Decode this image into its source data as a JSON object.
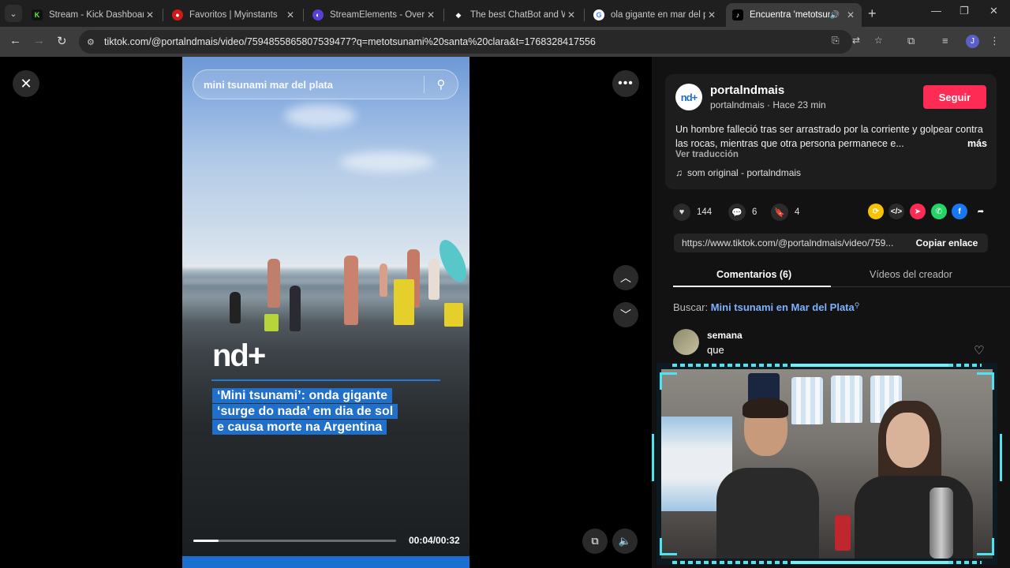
{
  "browser": {
    "tabs": [
      {
        "title": "Stream - Kick Dashboard",
        "favicon": "kick-icon",
        "color": "#53fc18"
      },
      {
        "title": "Favoritos | Myinstants",
        "favicon": "myinstants-icon",
        "color": "#d11a1a"
      },
      {
        "title": "StreamElements - Overlays",
        "favicon": "streamelements-icon",
        "color": "#5a3fd6"
      },
      {
        "title": "The best ChatBot and Wid",
        "favicon": "chatbot-icon",
        "color": "#ffffff"
      },
      {
        "title": "ola gigante en mar del pla",
        "favicon": "google-icon",
        "color": "#4285f4"
      },
      {
        "title": "Encuentra 'metotsuna",
        "favicon": "tiktok-icon",
        "color": "#000000",
        "active": true
      }
    ],
    "url": "tiktok.com/@portalndmais/video/7594855865807539477?q=metotsunami%20santa%20clara&t=1768328417556",
    "profile_initial": "J"
  },
  "video": {
    "search_query": "mini tsunami mar del plata",
    "logo_text": "nd+",
    "headline_lines": [
      "‘Mini tsunami’: onda gigante",
      "‘surge do nada’ em dia de sol",
      "e causa morte na Argentina"
    ],
    "time": "00:04/00:32",
    "progress": 0.125
  },
  "panel": {
    "avatar_text": "nd+",
    "username": "portalndmais",
    "subline": "portalndmais · Hace 23 min",
    "follow_label": "Seguir",
    "description": "Un hombre falleció tras ser arrastrado por la corriente y golpear contra las rocas, mientras que otra persona permanece e...",
    "more_label": "más",
    "translate_label": "Ver traducción",
    "music": "som original - portalndmais",
    "likes": "144",
    "comments_count": "6",
    "saves": "4",
    "share_link": "https://www.tiktok.com/@portalndmais/video/759...",
    "copy_label": "Copiar enlace",
    "tab_comments": "Comentarios (6)",
    "tab_creator": "Vídeos del creador",
    "search_prefix": "Buscar:",
    "search_keyword": "Mini tsunami en Mar del Plata",
    "comment": {
      "user": "semana",
      "text": "que"
    }
  }
}
